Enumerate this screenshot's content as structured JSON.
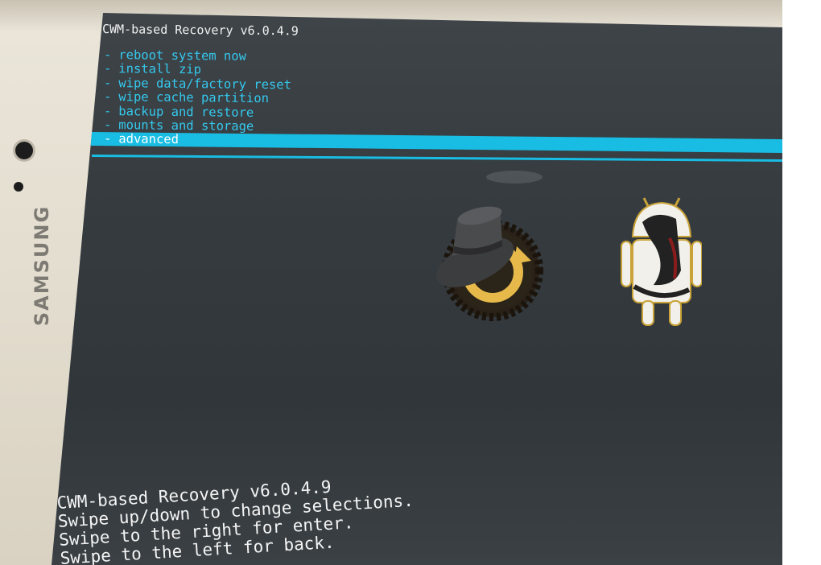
{
  "device": {
    "brand": "SAMSUNG"
  },
  "recovery": {
    "title": "CWM-based Recovery v6.0.4.9",
    "menu_items": [
      {
        "dash": "-",
        "label": "reboot system now",
        "selected": false
      },
      {
        "dash": "-",
        "label": "install zip",
        "selected": false
      },
      {
        "dash": "-",
        "label": "wipe data/factory reset",
        "selected": false
      },
      {
        "dash": "-",
        "label": "wipe cache partition",
        "selected": false
      },
      {
        "dash": "-",
        "label": "backup and restore",
        "selected": false
      },
      {
        "dash": "-",
        "label": "mounts and storage",
        "selected": false
      },
      {
        "dash": "-",
        "label": "advanced",
        "selected": true
      }
    ],
    "logo_icons": [
      "clockworkmod-hat-gear-icon",
      "android-fsu-seal-icon"
    ],
    "footer_lines": [
      "CWM-based Recovery v6.0.4.9",
      "Swipe up/down to change selections.",
      "Swipe to the right for enter.",
      "Swipe to the left for back."
    ]
  },
  "colors": {
    "menu_text": "#35c9ef",
    "selection_bar": "#19bde3",
    "screen_bg": "#353b3f",
    "bezel": "#e5dfd2"
  }
}
